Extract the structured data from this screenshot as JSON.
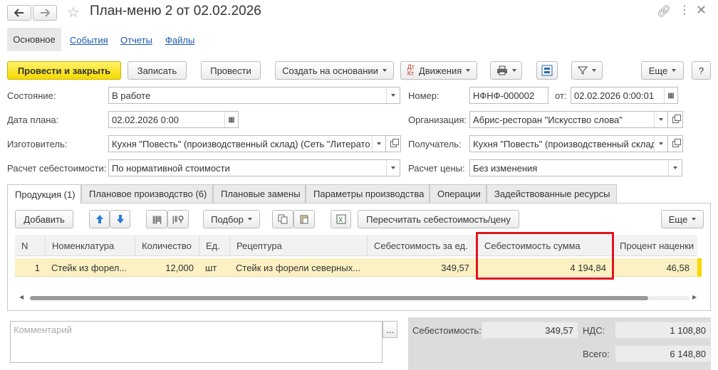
{
  "window": {
    "title": "План-меню 2 от 02.02.2026"
  },
  "nav_tabs": [
    "Основное",
    "События",
    "Отчеты",
    "Файлы"
  ],
  "toolbar": {
    "post_close": "Провести и закрыть",
    "save": "Записать",
    "post": "Провести",
    "create_based": "Создать на основании",
    "movements": "Движения",
    "more": "Еще",
    "help": "?"
  },
  "form": {
    "state_label": "Состояние:",
    "state_value": "В работе",
    "plan_date_label": "Дата плана:",
    "plan_date_value": "02.02.2026  0:00",
    "maker_label": "Изготовитель:",
    "maker_value": "Кухня \"Повесть\" (производственный склад)  (Сеть \"Литерато",
    "cost_calc_label": "Расчет себестоимости:",
    "cost_calc_value": "По нормативной стоимости",
    "number_label": "Номер:",
    "number_value": "НФНФ-000002",
    "from_label": "от:",
    "from_value": "02.02.2026  0:00:01",
    "org_label": "Организация:",
    "org_value": "Абрис-ресторан \"Искусство слова\"",
    "receiver_label": "Получатель:",
    "receiver_value": "Кухня \"Повесть\" (производственный склад)",
    "price_calc_label": "Расчет цены:",
    "price_calc_value": "Без изменения"
  },
  "tabs": [
    "Продукция (1)",
    "Плановое производство (6)",
    "Плановые замены",
    "Параметры производства",
    "Операции",
    "Задействованные ресурсы"
  ],
  "grid_toolbar": {
    "add": "Добавить",
    "selection": "Подбор",
    "recalc": "Пересчитать себестоимость/цену",
    "more": "Еще"
  },
  "table": {
    "headers": [
      "N",
      "Номенклатура",
      "Количество",
      "Ед.",
      "Рецептура",
      "Себестоимость за ед.",
      "Себестоимость сумма",
      "Процент наценки"
    ],
    "rows": [
      [
        "1",
        "Стейк из форел...",
        "12,000",
        "шт",
        "Стейк из форели северных...",
        "349,57",
        "4 194,84",
        "46,58"
      ]
    ]
  },
  "comment": {
    "placeholder": "Комментарий",
    "button": "..."
  },
  "totals": {
    "cost_label": "Себестоимость:",
    "cost_value": "349,57",
    "vat_label": "НДС:",
    "vat_value": "1 108,80",
    "total_label": "Всего:",
    "total_value": "6 148,80"
  },
  "colors": {
    "primary_button": "#f5d900",
    "selected_row": "#fbf1c2",
    "highlight_box": "#e0141e",
    "link": "#1a5aa8"
  }
}
